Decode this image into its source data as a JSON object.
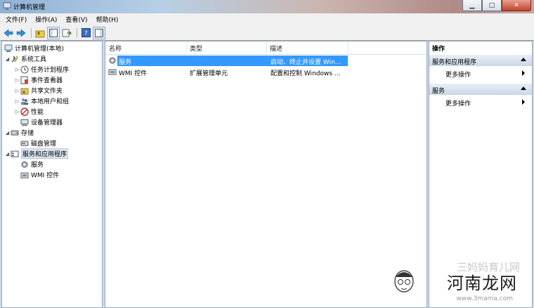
{
  "window": {
    "title": "计算机管理"
  },
  "menu": {
    "items": [
      "文件(F)",
      "操作(A)",
      "查看(V)",
      "帮助(H)"
    ]
  },
  "tree": {
    "root": "计算机管理(本地)",
    "items": [
      {
        "label": "系统工具"
      },
      {
        "label": "任务计划程序"
      },
      {
        "label": "事件查看器"
      },
      {
        "label": "共享文件夹"
      },
      {
        "label": "本地用户和组"
      },
      {
        "label": "性能"
      },
      {
        "label": "设备管理器"
      },
      {
        "label": "存储"
      },
      {
        "label": "磁盘管理"
      },
      {
        "label": "服务和应用程序"
      },
      {
        "label": "服务"
      },
      {
        "label": "WMI 控件"
      }
    ]
  },
  "list": {
    "columns": [
      "名称",
      "类型",
      "描述"
    ],
    "rows": [
      {
        "name": "服务",
        "type": "",
        "desc": "启动、终止并设置 Win..."
      },
      {
        "name": "WMI 控件",
        "type": "扩展管理单元",
        "desc": "配置和控制 Windows ..."
      }
    ]
  },
  "actions": {
    "title": "操作",
    "sections": [
      {
        "header": "服务和应用程序",
        "item": "更多操作"
      },
      {
        "header": "服务",
        "item": "更多操作"
      }
    ]
  },
  "watermark": {
    "brand": "河南龙网",
    "url": "www.3mama.com",
    "faint": "三妈妈育儿网"
  },
  "colors": {
    "selection": "#3399ff",
    "action_header": "#cad7e8"
  }
}
